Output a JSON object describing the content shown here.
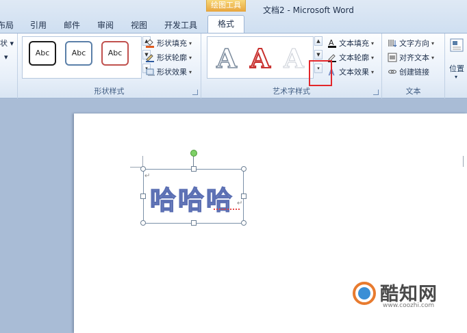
{
  "window": {
    "title": "文档2 - Microsoft Word",
    "context_group": "绘图工具"
  },
  "tabs": [
    {
      "label": "布局"
    },
    {
      "label": "引用"
    },
    {
      "label": "邮件"
    },
    {
      "label": "审阅"
    },
    {
      "label": "视图"
    },
    {
      "label": "开发工具"
    },
    {
      "label": "格式"
    }
  ],
  "ribbon": {
    "left_partial": {
      "caret1": "状 ▾",
      "caret2": "▾"
    },
    "shape_styles": {
      "label": "形状样式",
      "samples": [
        "Abc",
        "Abc",
        "Abc"
      ],
      "fill": "形状填充",
      "outline": "形状轮廓",
      "effects": "形状效果"
    },
    "wordart_styles": {
      "label": "艺术字样式",
      "letters": [
        "A",
        "A",
        "A"
      ],
      "text_fill": "文本填充",
      "text_outline": "文本轮廓",
      "text_effects": "文本效果"
    },
    "text_group": {
      "label": "文本",
      "direction": "文字方向",
      "align": "对齐文本",
      "link": "创建链接"
    },
    "arrange": {
      "position": "位置"
    }
  },
  "document": {
    "textbox_text": "哈哈哈"
  },
  "watermark": {
    "brand": "酷知网",
    "url": "www.coozhi.com"
  },
  "colors": {
    "highlight": "#e3262a",
    "accent": "#f0b445",
    "wordart_red": "#c8302e"
  }
}
